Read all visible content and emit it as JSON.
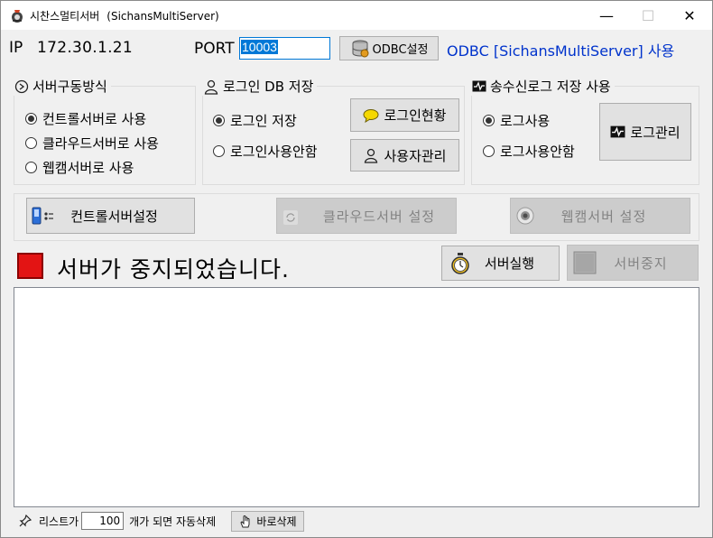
{
  "window": {
    "title": "시찬스멀티서버",
    "subtitle": "(SichansMultiServer)",
    "minimize": "—",
    "maximize": "☐",
    "close": "✕"
  },
  "connection": {
    "ip_label": "IP",
    "ip_value": "172.30.1.21",
    "port_label": "PORT",
    "port_value": "10003",
    "odbc_button": "ODBC설정",
    "odbc_info": "ODBC [SichansMultiServer] 사용"
  },
  "server_mode": {
    "title": "서버구동방식",
    "options": [
      {
        "label": "컨트롤서버로 사용",
        "checked": true
      },
      {
        "label": "클라우드서버로 사용",
        "checked": false
      },
      {
        "label": "웹캠서버로 사용",
        "checked": false
      }
    ]
  },
  "login_db": {
    "title": "로그인 DB 저장",
    "options": [
      {
        "label": "로그인 저장",
        "checked": true
      },
      {
        "label": "로그인사용안함",
        "checked": false
      }
    ],
    "status_button": "로그인현황",
    "user_button": "사용자관리"
  },
  "comm_log": {
    "title": "송수신로그 저장 사용",
    "options": [
      {
        "label": "로그사용",
        "checked": true
      },
      {
        "label": "로그사용안함",
        "checked": false
      }
    ],
    "manage_button": "로그관리"
  },
  "settings_bar": {
    "control_button": "컨트롤서버설정",
    "cloud_button": "클라우드서버 설정",
    "webcam_button": "웹캠서버 설정"
  },
  "status": {
    "text": "서버가 중지되었습니다.",
    "indicator_color": "#e31414",
    "run_button": "서버실행",
    "stop_button": "서버중지"
  },
  "footer": {
    "prefix": "리스트가",
    "count": "100",
    "suffix": "개가 되면 자동삭제",
    "delete_button": "바로삭제"
  }
}
